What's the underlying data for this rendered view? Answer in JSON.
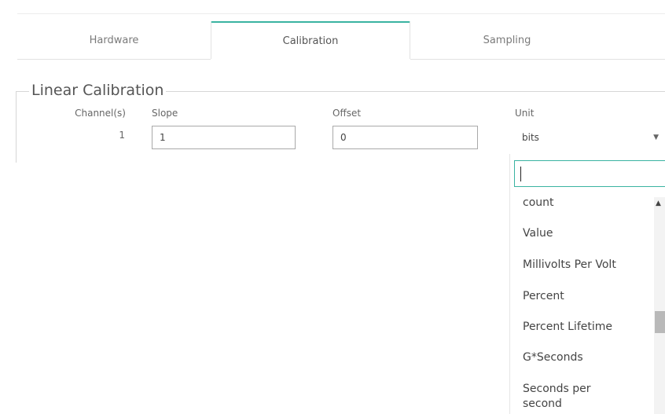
{
  "tabs": {
    "hardware": "Hardware",
    "calibration": "Calibration",
    "sampling": "Sampling",
    "active": "Calibration"
  },
  "calibration": {
    "legend": "Linear Calibration",
    "channels_label": "Channel(s)",
    "slope_label": "Slope",
    "offset_label": "Offset",
    "unit_label": "Unit",
    "channel": "1",
    "slope": "1",
    "offset": "0",
    "unit": "bits"
  },
  "unit_dropdown": {
    "search_value": "",
    "options": [
      "count",
      "Value",
      "Millivolts Per Volt",
      "Percent",
      "Percent Lifetime",
      "G*Seconds",
      "Seconds per second"
    ]
  },
  "colors": {
    "accent": "#3ab3a1"
  }
}
